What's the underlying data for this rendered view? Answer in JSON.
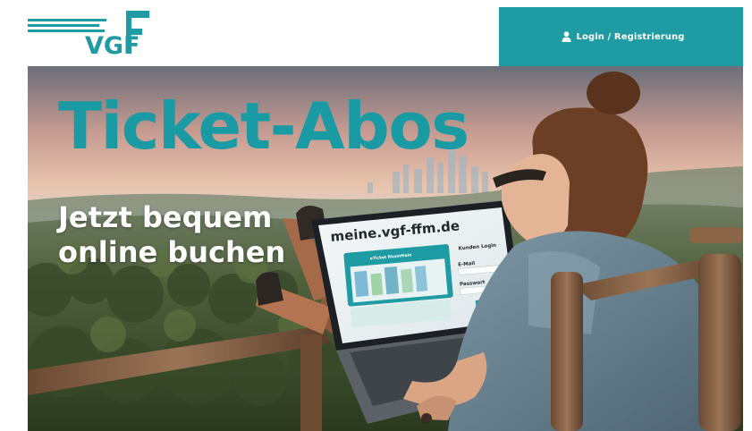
{
  "brand": {
    "logo_text": "VGF"
  },
  "header": {
    "login_label": "Login / Registrierung",
    "login_icon": "user-icon",
    "accent_color": "#1e9ba3"
  },
  "hero": {
    "headline": "Ticket-Abos",
    "subline_line1": "Jetzt bequem",
    "subline_line2": "online buchen",
    "headline_color": "#1a9aa3"
  },
  "laptop_screen": {
    "url": "meine.vgf-ffm.de",
    "card_title": "eTicket RheinMain",
    "login_panel_title": "Kunden Login",
    "email_label": "E-Mail",
    "password_label": "Passwort"
  }
}
